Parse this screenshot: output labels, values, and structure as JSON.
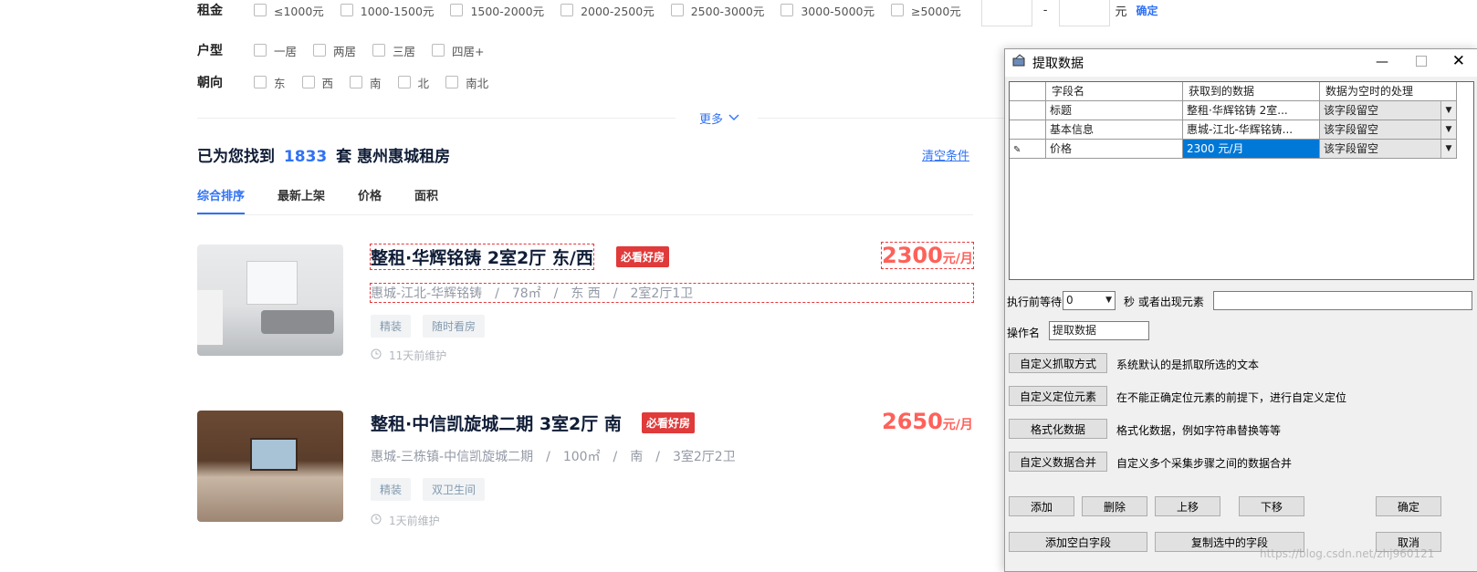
{
  "filters": {
    "rent": {
      "label": "租金",
      "options": [
        "≤1000元",
        "1000-1500元",
        "1500-2000元",
        "2000-2500元",
        "2500-3000元",
        "3000-5000元",
        "≥5000元"
      ],
      "range_sep": "-",
      "unit": "元",
      "confirm": "确定"
    },
    "layout": {
      "label": "户型",
      "options": [
        "一居",
        "两居",
        "三居",
        "四居+"
      ]
    },
    "orientation": {
      "label": "朝向",
      "options": [
        "东",
        "西",
        "南",
        "北",
        "南北"
      ]
    },
    "more": "更多"
  },
  "results": {
    "prefix": "已为您找到",
    "count": "1833",
    "suffix": "套 惠州惠城租房",
    "clear": "清空条件"
  },
  "sort_tabs": [
    "综合排序",
    "最新上架",
    "价格",
    "面积"
  ],
  "listings": [
    {
      "title": "整租·华辉铭铸 2室2厅 东/西",
      "badge": "必看好房",
      "price": "2300",
      "price_unit": "元/月",
      "info": "惠城-江北-华辉铭铸　/　78㎡　/　东 西　/　2室2厅1卫",
      "tags": [
        "精装",
        "随时看房"
      ],
      "maintained": "11天前维护"
    },
    {
      "title": "整租·中信凯旋城二期 3室2厅 南",
      "badge": "必看好房",
      "price": "2650",
      "price_unit": "元/月",
      "info": "惠城-三栋镇-中信凯旋城二期　/　100㎡　/　南　/　3室2厅2卫",
      "tags": [
        "精装",
        "双卫生间"
      ],
      "maintained": "1天前维护"
    }
  ],
  "dialog": {
    "title": "提取数据",
    "columns": [
      "字段名",
      "获取到的数据",
      "数据为空时的处理"
    ],
    "rows": [
      {
        "field": "标题",
        "data": "整租·华辉铭铸 2室...",
        "handling": "该字段留空"
      },
      {
        "field": "基本信息",
        "data": "惠城-江北-华辉铭铸...",
        "handling": "该字段留空"
      },
      {
        "field": "价格",
        "data": "2300 元/月",
        "handling": "该字段留空"
      }
    ],
    "wait_label": "执行前等待",
    "wait_value": "0",
    "wait_suffix": "秒 或者出现元素",
    "op_label": "操作名",
    "op_value": "提取数据",
    "actions": [
      {
        "button": "自定义抓取方式",
        "desc": "系统默认的是抓取所选的文本"
      },
      {
        "button": "自定义定位元素",
        "desc": "在不能正确定位元素的前提下，进行自定义定位"
      },
      {
        "button": "格式化数据",
        "desc": "格式化数据，例如字符串替换等等"
      },
      {
        "button": "自定义数据合并",
        "desc": "自定义多个采集步骤之间的数据合并"
      }
    ],
    "btn_add": "添加",
    "btn_delete": "删除",
    "btn_up": "上移",
    "btn_down": "下移",
    "btn_ok": "确定",
    "btn_add_blank": "添加空白字段",
    "btn_copy": "复制选中的字段",
    "btn_cancel": "取消"
  },
  "watermark": "https://blog.csdn.net/zhj960121",
  "colors": {
    "accent": "#3072f6",
    "price": "#fe615a",
    "badge": "#e03a3a",
    "selection": "#0078d7"
  }
}
